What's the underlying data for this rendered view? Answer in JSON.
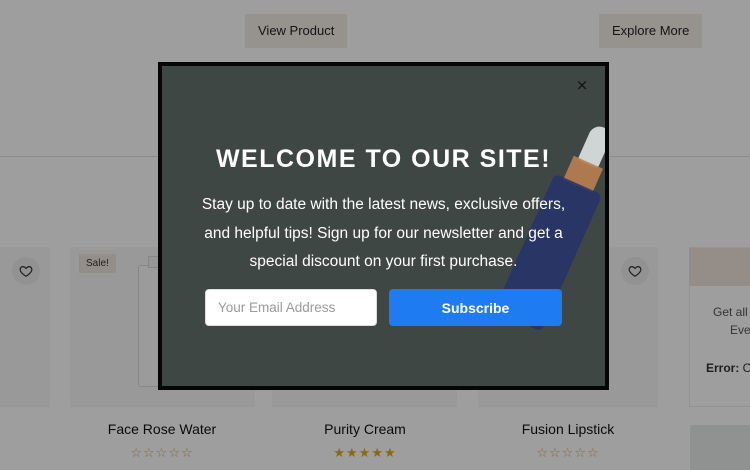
{
  "background_page": {
    "buttons": {
      "view_product": "View Product",
      "explore_more": "Explore More"
    },
    "sale_badge": "Sale!",
    "side_panel": {
      "text1": "Get all",
      "text2": "Eve",
      "error_label": "Error:",
      "error_value": " C"
    },
    "products": [
      {
        "name": "Face Rose Water",
        "stars": "☆☆☆☆☆"
      },
      {
        "name": "Purity Cream",
        "stars": "★★★★★"
      },
      {
        "name": "Fusion Lipstick",
        "stars": "☆☆☆☆☆"
      }
    ]
  },
  "modal": {
    "close_symbol": "×",
    "title": "WELCOME TO OUR SITE!",
    "description": "Stay up to date with the latest news, exclusive offers, and helpful tips! Sign up for our newsletter and get a special discount on your first purchase.",
    "email_placeholder": "Your Email Address",
    "subscribe_label": "Subscribe"
  },
  "colors": {
    "modal_background": "#3f4744",
    "subscribe_button": "#1f7bf2",
    "modal_border": "#050505"
  },
  "icons": [
    "heart-icon",
    "close-icon"
  ]
}
